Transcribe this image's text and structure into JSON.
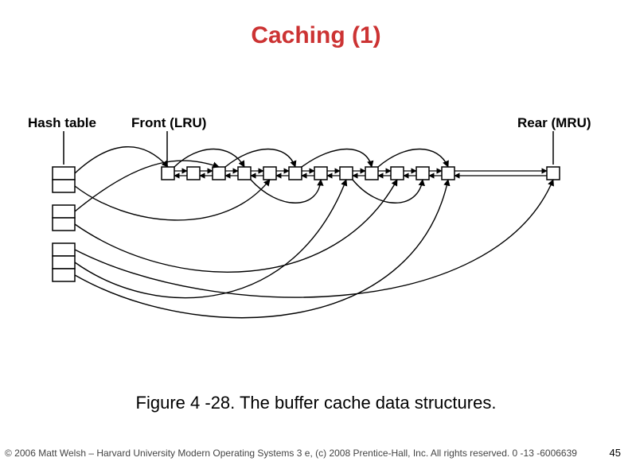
{
  "title": "Caching (1)",
  "labels": {
    "hash_table": "Hash table",
    "front": "Front (LRU)",
    "rear": "Rear (MRU)"
  },
  "caption": "Figure 4 -28. The buffer cache data structures.",
  "footer_left": "© 2006 Matt Welsh – Harvard University Modern Operating Systems 3 e, (c) 2008 Prentice-Hall, Inc. All rights reserved. 0 -13 -6006639",
  "page_number": "45"
}
